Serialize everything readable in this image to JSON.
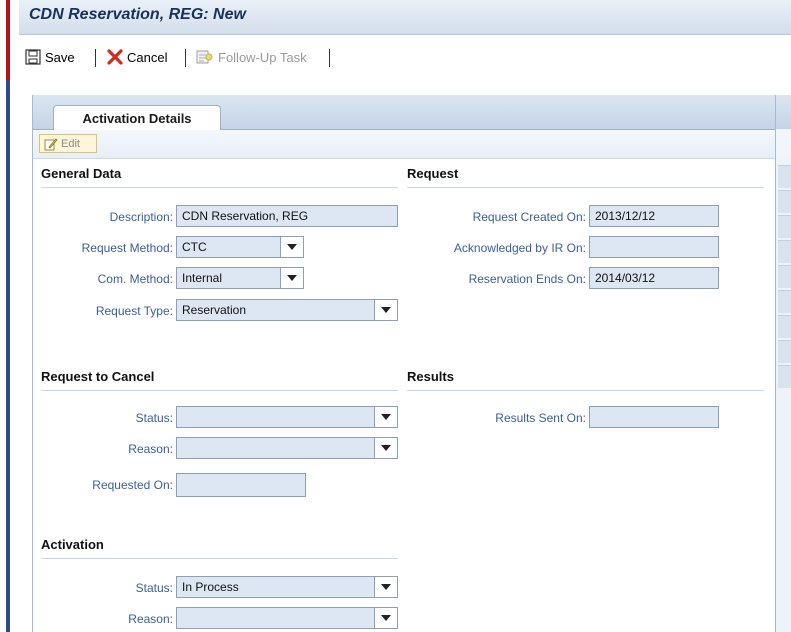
{
  "window": {
    "title": "CDN Reservation, REG: New"
  },
  "toolbar": {
    "save": "Save",
    "cancel": "Cancel",
    "followup": "Follow-Up Task"
  },
  "tabs": {
    "active": "Activation Details"
  },
  "edit_button": "Edit",
  "general_data": {
    "title": "General Data",
    "description_label": "Description:",
    "description_value": "CDN Reservation, REG",
    "request_method_label": "Request Method:",
    "request_method_value": "CTC",
    "com_method_label": "Com. Method:",
    "com_method_value": "Internal",
    "request_type_label": "Request Type:",
    "request_type_value": "Reservation"
  },
  "request": {
    "title": "Request",
    "created_label": "Request Created On:",
    "created_value": "2013/12/12",
    "ack_label": "Acknowledged by IR On:",
    "ack_value": "",
    "res_ends_label": "Reservation Ends On:",
    "res_ends_value": "2014/03/12"
  },
  "request_to_cancel": {
    "title": "Request to Cancel",
    "status_label": "Status:",
    "status_value": "",
    "reason_label": "Reason:",
    "reason_value": "",
    "requested_label": "Requested On:",
    "requested_value": ""
  },
  "results": {
    "title": "Results",
    "sent_label": "Results Sent On:",
    "sent_value": ""
  },
  "activation": {
    "title": "Activation",
    "status_label": "Status:",
    "status_value": "In Process",
    "reason_label": "Reason:",
    "reason_value": ""
  },
  "colors": {
    "title_text": "#19315a",
    "label_text": "#3a5f9b",
    "field_bg": "#dde7f3",
    "cancel_icon": "#d42a1c"
  }
}
